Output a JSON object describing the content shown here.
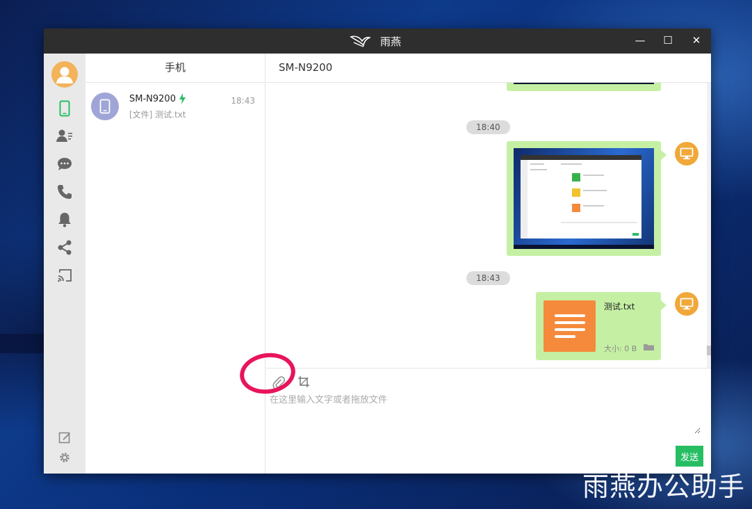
{
  "window": {
    "title": "雨燕",
    "controls": {
      "minimize": "—",
      "maximize": "☐",
      "close": "✕"
    }
  },
  "sidebar": {
    "items": [
      {
        "name": "phone",
        "active": true
      },
      {
        "name": "contacts"
      },
      {
        "name": "messages"
      },
      {
        "name": "calls"
      },
      {
        "name": "notifications"
      },
      {
        "name": "share"
      },
      {
        "name": "cast"
      }
    ],
    "bottom": [
      "edit",
      "settings"
    ]
  },
  "contacts": {
    "header": "手机",
    "items": [
      {
        "name": "SM-N9200",
        "time": "18:43",
        "preview": "[文件] 测试.txt"
      }
    ]
  },
  "chat": {
    "title": "SM-N9200",
    "stamps": [
      "18:40",
      "18:43"
    ],
    "file": {
      "name": "测试.txt",
      "size": "大小: 0 B"
    }
  },
  "composer": {
    "placeholder": "在这里输入文字或者拖放文件",
    "send_label": "发送"
  },
  "watermark": "雨燕办公助手",
  "colors": {
    "accent_green": "#27be63",
    "bubble_green": "#c5f0a4",
    "highlight": "#e8145d",
    "device_avatar": "#f0a839",
    "file_icon": "#f58a3c"
  }
}
